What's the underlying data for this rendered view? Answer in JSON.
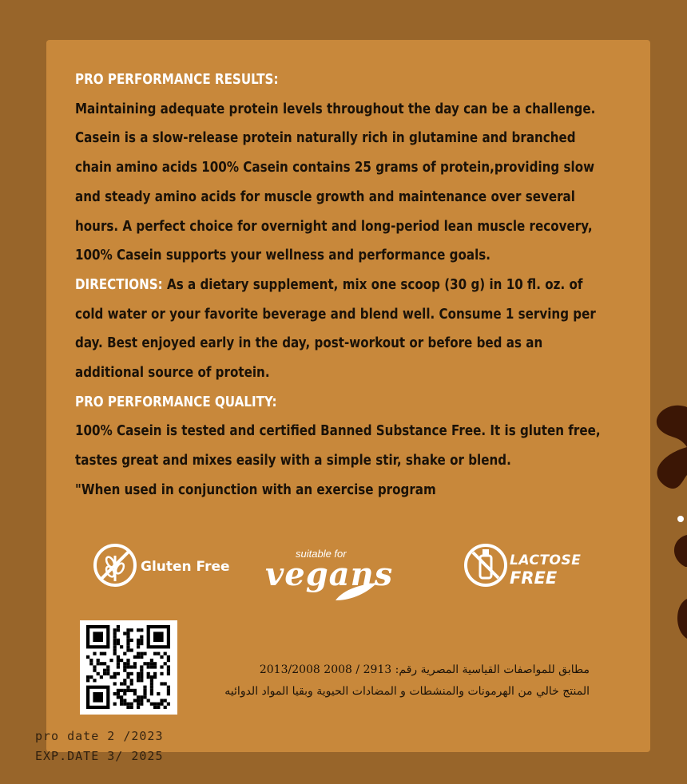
{
  "sections": {
    "results_heading": "PRO PERFORMANCE RESULTS:",
    "results_lines": [
      "Maintaining adequate protein levels throughout the day can be a challenge.",
      "Casein is a slow-release protein naturally rich in glutamine and branched",
      "chain amino acids 100% Casein contains 25 grams of protein,providing slow",
      "and steady amino acids for muscle growth and maintenance over several",
      "hours. A perfect choice for overnight and long-period lean muscle recovery,",
      "100% Casein supports your wellness and performance goals."
    ],
    "directions_label": "DIRECTIONS:",
    "directions_lines": [
      " As a dietary supplement, mix one scoop (30 g) in 10 fl. oz. of",
      "cold water or your favorite beverage and blend well. Consume 1 serving per",
      "day. Best enjoyed early in the day, post-workout or before bed as an",
      "additional source of protein."
    ],
    "quality_heading": "PRO PERFORMANCE QUALITY:",
    "quality_lines": [
      "100% Casein is tested and certified Banned Substance Free. It is gluten free,",
      "tastes great and mixes easily with a simple stir, shake or blend.",
      "\"When used in conjunction with an exercise program"
    ]
  },
  "badges": {
    "gluten": "Gluten Free",
    "vegan_small": "suitable for",
    "vegan_big": "vegans",
    "lactose_1": "LACTOSE",
    "lactose_2": "FREE"
  },
  "arabic": {
    "line1": "مطابق للمواصفات القياسية المصرية رقم: 2913 / 2008 2013/2008",
    "line2": "المنتج خالي من الهرمونات والمنشطات و المضادات الحيوية وبقيا المواد الدوائيه"
  },
  "dates": {
    "pro": "pro date 2 /2023",
    "exp": "EXP.DATE 3/ 2025"
  },
  "icons": [
    "gluten-free-icon",
    "vegan-leaf-icon",
    "lactose-free-bottle-icon",
    "qr-code"
  ],
  "colors": {
    "panel": "#c8883b",
    "background": "#98652a",
    "text": "#1b1208",
    "heading": "#ffffff",
    "splash": "#3b1605"
  }
}
